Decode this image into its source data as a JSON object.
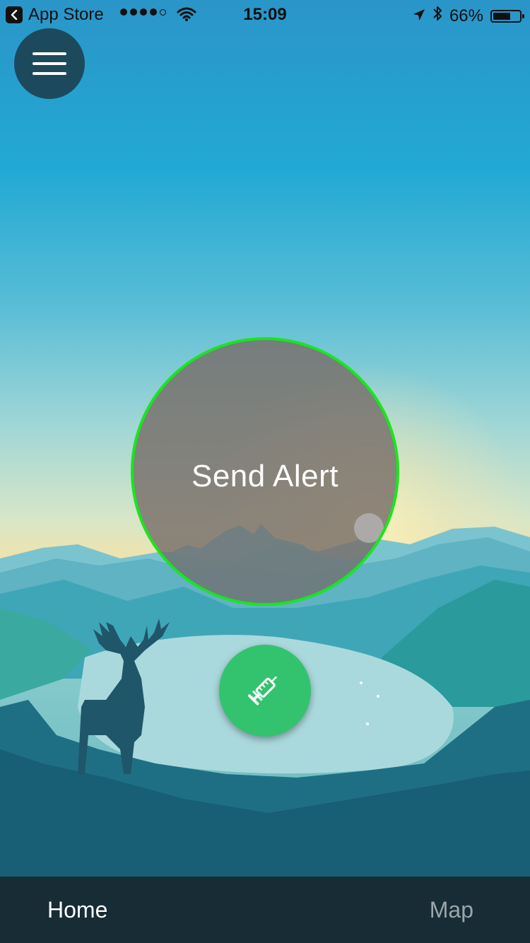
{
  "status_bar": {
    "back_app": "App Store",
    "time": "15:09",
    "battery": "66%",
    "battery_level": 0.66,
    "signal_bars_filled": 4,
    "signal_bars_total": 5
  },
  "main": {
    "alert_label": "Send Alert"
  },
  "tabs": [
    {
      "label": "Home",
      "active": true
    },
    {
      "label": "Map",
      "active": false
    }
  ],
  "colors": {
    "alert_ring": "#18e61e",
    "syringe_button": "#33c36f",
    "menu_button": "#1c4a5c",
    "tab_bar": "#172c35"
  },
  "icons": {
    "menu": "hamburger-icon",
    "action": "syringe-icon",
    "back": "chevron-left-icon",
    "wifi": "wifi-icon",
    "location": "location-arrow-icon",
    "bluetooth": "bluetooth-icon",
    "battery": "battery-icon"
  }
}
